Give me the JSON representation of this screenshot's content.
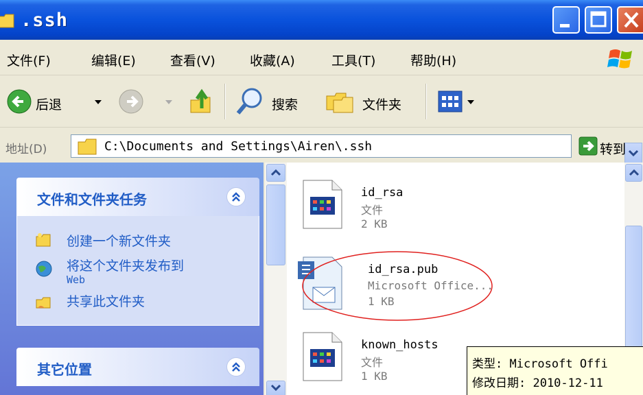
{
  "window": {
    "title": ".ssh"
  },
  "menu": {
    "items": [
      "文件(F)",
      "编辑(E)",
      "查看(V)",
      "收藏(A)",
      "工具(T)",
      "帮助(H)"
    ]
  },
  "toolbar": {
    "back_label": "后退",
    "search_label": "搜索",
    "folders_label": "文件夹"
  },
  "address": {
    "label": "地址(D)",
    "path": "C:\\Documents and Settings\\Airen\\.ssh",
    "go_label": "转到"
  },
  "taskpane": {
    "file_tasks": {
      "title": "文件和文件夹任务",
      "items": [
        "创建一个新文件夹",
        "将这个文件夹发布到",
        "Web",
        "共享此文件夹"
      ]
    },
    "other_places": {
      "title": "其它位置"
    }
  },
  "files": [
    {
      "name": "id_rsa",
      "type": "文件",
      "size": "2 KB"
    },
    {
      "name": "id_rsa.pub",
      "type": "Microsoft Office...",
      "size": "1 KB"
    },
    {
      "name": "known_hosts",
      "type": "文件",
      "size": "1 KB"
    }
  ],
  "tooltip": {
    "line1": "类型: Microsoft Offi",
    "line2": "修改日期: 2010-12-11"
  },
  "colors": {
    "titlebar": "#0a52dc",
    "taskpane": "#7ba2e7",
    "link": "#215dc6",
    "annotation": "#e0201e"
  }
}
